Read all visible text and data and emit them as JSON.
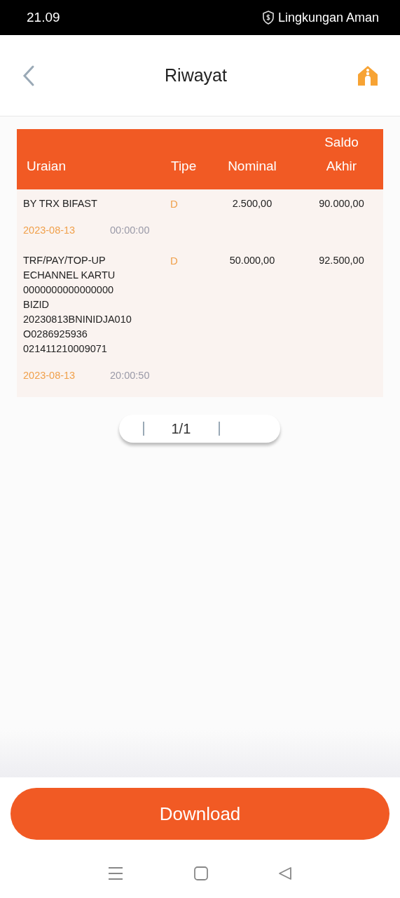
{
  "status_bar": {
    "time": "21.09",
    "security_label": "Lingkungan Aman"
  },
  "header": {
    "title": "Riwayat"
  },
  "table": {
    "columns": [
      "Uraian",
      "Tipe",
      "Nominal",
      "Saldo\nAkhir"
    ],
    "rows": [
      {
        "description": "BY TRX BIFAST",
        "type": "D",
        "nominal": "2.500,00",
        "balance": "90.000,00",
        "date": "2023-08-13",
        "time": "00:00:00"
      },
      {
        "description": "TRF/PAY/TOP-UP\nECHANNEL KARTU\n0000000000000000\nBIZID\n20230813BNINIDJA010\nO0286925936\n021411210009071",
        "type": "D",
        "nominal": "50.000,00",
        "balance": "92.500,00",
        "date": "2023-08-13",
        "time": "20:00:50"
      }
    ]
  },
  "pager": {
    "label": "1/1"
  },
  "download_button": {
    "label": "Download"
  }
}
